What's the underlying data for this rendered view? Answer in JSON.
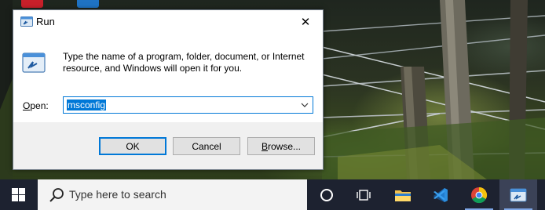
{
  "desktop": {
    "icons": [
      "red-app-icon",
      "blue-app-icon"
    ]
  },
  "run_dialog": {
    "title": "Run",
    "close_glyph": "✕",
    "description": "Type the name of a program, folder, document, or Internet resource, and Windows will open it for you.",
    "open_label_underlined": "O",
    "open_label_rest": "pen:",
    "open_value": "msconfig",
    "buttons": {
      "ok": "OK",
      "cancel": "Cancel",
      "browse_underlined": "B",
      "browse_rest": "rowse..."
    },
    "accent_color": "#0078d7"
  },
  "taskbar": {
    "search_placeholder": "Type here to search",
    "items": [
      "start-icon",
      "cortana-icon",
      "task-view-icon",
      "file-explorer-icon",
      "vscode-icon",
      "chrome-icon",
      "run-app-icon"
    ],
    "background_color": "#1d2230"
  }
}
